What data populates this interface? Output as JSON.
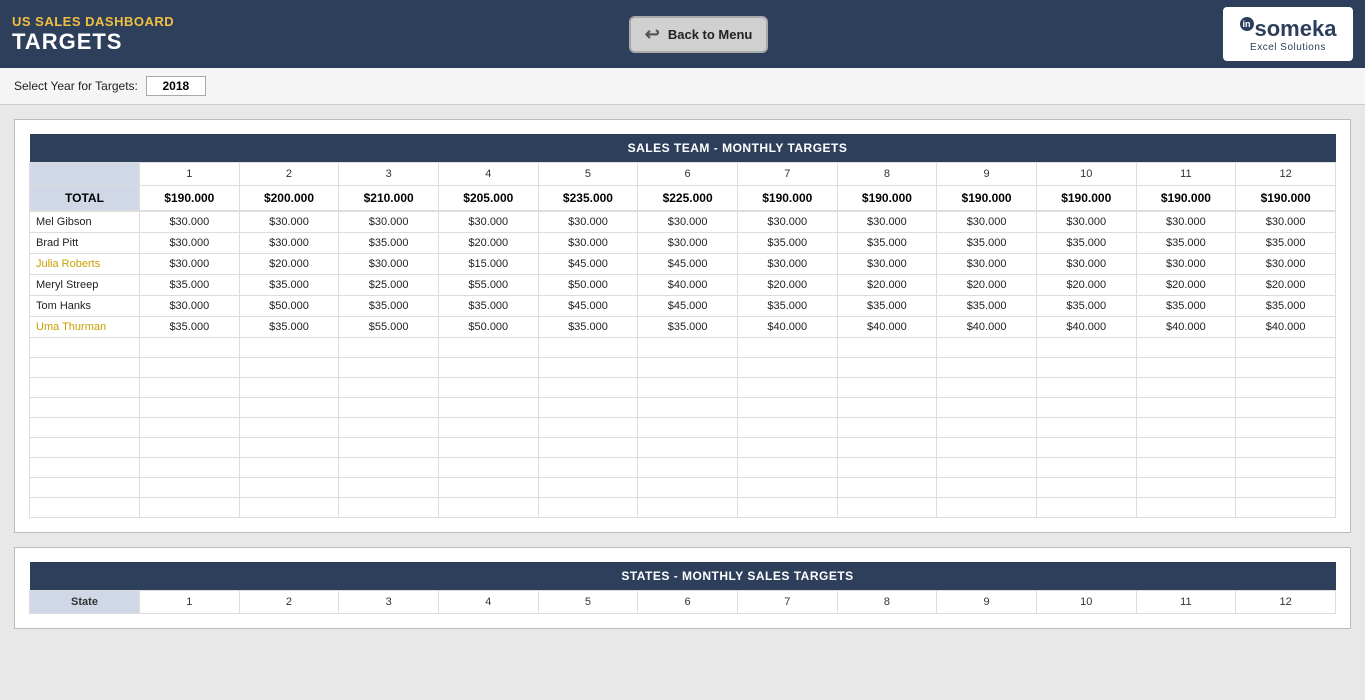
{
  "header": {
    "title_top": "US SALES DASHBOARD",
    "title_bottom": "TARGETS",
    "back_label": "Back to Menu",
    "logo_main": "someka",
    "logo_sub": "Excel Solutions",
    "logo_circle": "in"
  },
  "year_selector": {
    "label": "Select Year for Targets:",
    "value": "2018"
  },
  "sales_team_table": {
    "section_header": "SALES TEAM - MONTHLY TARGETS",
    "col_headers": [
      "",
      "1",
      "2",
      "3",
      "4",
      "5",
      "6",
      "7",
      "8",
      "9",
      "10",
      "11",
      "12"
    ],
    "total_label": "TOTAL",
    "totals": [
      "$190.000",
      "$200.000",
      "$210.000",
      "$205.000",
      "$235.000",
      "$225.000",
      "$190.000",
      "$190.000",
      "$190.000",
      "$190.000",
      "$190.000",
      "$190.000"
    ],
    "rows": [
      {
        "name": "Mel Gibson",
        "color": "black",
        "values": [
          "$30.000",
          "$30.000",
          "$30.000",
          "$30.000",
          "$30.000",
          "$30.000",
          "$30.000",
          "$30.000",
          "$30.000",
          "$30.000",
          "$30.000",
          "$30.000"
        ]
      },
      {
        "name": "Brad Pitt",
        "color": "black",
        "values": [
          "$30.000",
          "$30.000",
          "$35.000",
          "$20.000",
          "$30.000",
          "$30.000",
          "$35.000",
          "$35.000",
          "$35.000",
          "$35.000",
          "$35.000",
          "$35.000"
        ]
      },
      {
        "name": "Julia Roberts",
        "color": "yellow",
        "values": [
          "$30.000",
          "$20.000",
          "$30.000",
          "$15.000",
          "$45.000",
          "$45.000",
          "$30.000",
          "$30.000",
          "$30.000",
          "$30.000",
          "$30.000",
          "$30.000"
        ]
      },
      {
        "name": "Meryl Streep",
        "color": "black",
        "values": [
          "$35.000",
          "$35.000",
          "$25.000",
          "$55.000",
          "$50.000",
          "$40.000",
          "$20.000",
          "$20.000",
          "$20.000",
          "$20.000",
          "$20.000",
          "$20.000"
        ]
      },
      {
        "name": "Tom Hanks",
        "color": "black",
        "values": [
          "$30.000",
          "$50.000",
          "$35.000",
          "$35.000",
          "$45.000",
          "$45.000",
          "$35.000",
          "$35.000",
          "$35.000",
          "$35.000",
          "$35.000",
          "$35.000"
        ]
      },
      {
        "name": "Uma Thurman",
        "color": "yellow",
        "values": [
          "$35.000",
          "$35.000",
          "$55.000",
          "$50.000",
          "$35.000",
          "$35.000",
          "$40.000",
          "$40.000",
          "$40.000",
          "$40.000",
          "$40.000",
          "$40.000"
        ]
      }
    ],
    "empty_rows": 9
  },
  "states_table": {
    "section_header": "STATES - MONTHLY SALES TARGETS",
    "col_headers": [
      "State",
      "1",
      "2",
      "3",
      "4",
      "5",
      "6",
      "7",
      "8",
      "9",
      "10",
      "11",
      "12"
    ]
  }
}
